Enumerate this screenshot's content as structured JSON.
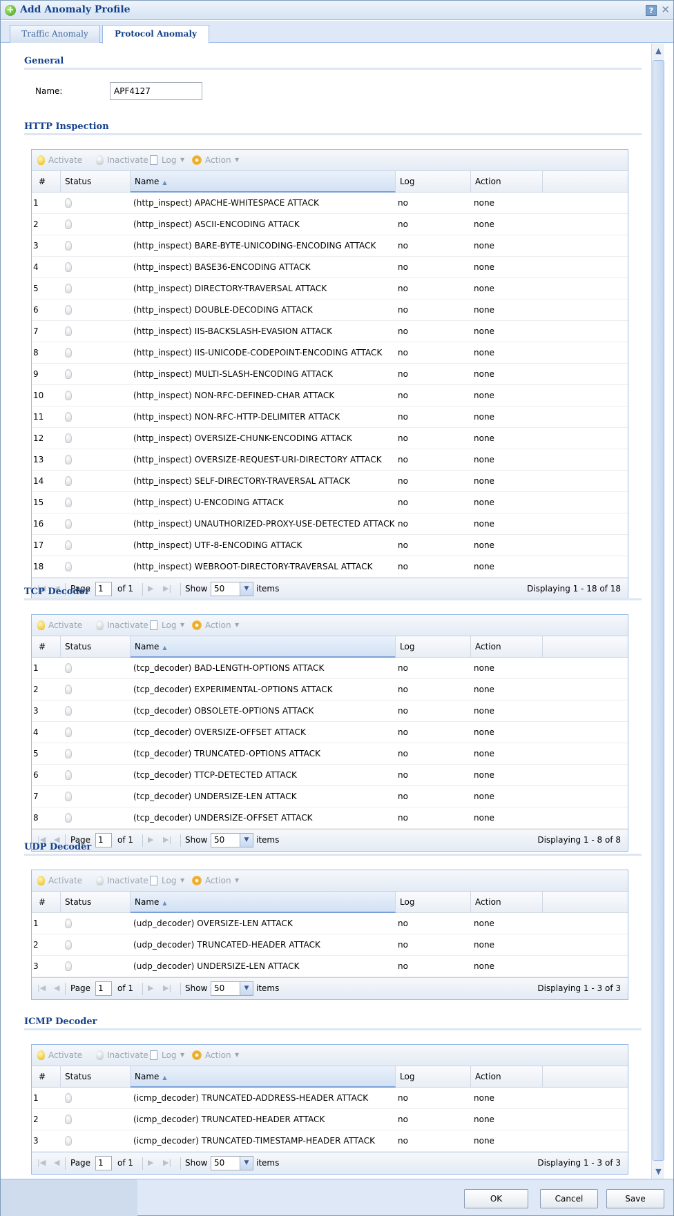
{
  "window": {
    "title": "Add Anomaly Profile",
    "help_label": "?",
    "close_label": "✕"
  },
  "tabs": [
    {
      "label": "Traffic Anomaly",
      "active": false
    },
    {
      "label": "Protocol Anomaly",
      "active": true
    }
  ],
  "general": {
    "title": "General",
    "name_label": "Name:",
    "name_value": "APF4127"
  },
  "toolbar": {
    "activate": "Activate",
    "inactivate": "Inactivate",
    "log": "Log",
    "action": "Action"
  },
  "columns": {
    "num": "#",
    "status": "Status",
    "name": "Name",
    "log": "Log",
    "action": "Action"
  },
  "pager": {
    "page_label": "Page",
    "page_value": "1",
    "of_label": "of 1",
    "show_label": "Show",
    "show_value": "50",
    "items_label": "items"
  },
  "sections": [
    {
      "title": "HTTP Inspection",
      "displaying": "Displaying 1 - 18 of 18",
      "rows": [
        {
          "num": "1",
          "name": "(http_inspect) APACHE-WHITESPACE ATTACK",
          "log": "no",
          "action": "none"
        },
        {
          "num": "2",
          "name": "(http_inspect) ASCII-ENCODING ATTACK",
          "log": "no",
          "action": "none"
        },
        {
          "num": "3",
          "name": "(http_inspect) BARE-BYTE-UNICODING-ENCODING ATTACK",
          "log": "no",
          "action": "none"
        },
        {
          "num": "4",
          "name": "(http_inspect) BASE36-ENCODING ATTACK",
          "log": "no",
          "action": "none"
        },
        {
          "num": "5",
          "name": "(http_inspect) DIRECTORY-TRAVERSAL ATTACK",
          "log": "no",
          "action": "none"
        },
        {
          "num": "6",
          "name": "(http_inspect) DOUBLE-DECODING ATTACK",
          "log": "no",
          "action": "none"
        },
        {
          "num": "7",
          "name": "(http_inspect) IIS-BACKSLASH-EVASION ATTACK",
          "log": "no",
          "action": "none"
        },
        {
          "num": "8",
          "name": "(http_inspect) IIS-UNICODE-CODEPOINT-ENCODING ATTACK",
          "log": "no",
          "action": "none"
        },
        {
          "num": "9",
          "name": "(http_inspect) MULTI-SLASH-ENCODING ATTACK",
          "log": "no",
          "action": "none"
        },
        {
          "num": "10",
          "name": "(http_inspect) NON-RFC-DEFINED-CHAR ATTACK",
          "log": "no",
          "action": "none"
        },
        {
          "num": "11",
          "name": "(http_inspect) NON-RFC-HTTP-DELIMITER ATTACK",
          "log": "no",
          "action": "none"
        },
        {
          "num": "12",
          "name": "(http_inspect) OVERSIZE-CHUNK-ENCODING ATTACK",
          "log": "no",
          "action": "none"
        },
        {
          "num": "13",
          "name": "(http_inspect) OVERSIZE-REQUEST-URI-DIRECTORY ATTACK",
          "log": "no",
          "action": "none"
        },
        {
          "num": "14",
          "name": "(http_inspect) SELF-DIRECTORY-TRAVERSAL ATTACK",
          "log": "no",
          "action": "none"
        },
        {
          "num": "15",
          "name": "(http_inspect) U-ENCODING ATTACK",
          "log": "no",
          "action": "none"
        },
        {
          "num": "16",
          "name": "(http_inspect) UNAUTHORIZED-PROXY-USE-DETECTED ATTACK",
          "log": "no",
          "action": "none"
        },
        {
          "num": "17",
          "name": "(http_inspect) UTF-8-ENCODING ATTACK",
          "log": "no",
          "action": "none"
        },
        {
          "num": "18",
          "name": "(http_inspect) WEBROOT-DIRECTORY-TRAVERSAL ATTACK",
          "log": "no",
          "action": "none"
        }
      ]
    },
    {
      "title": "TCP Decoder",
      "displaying": "Displaying 1 - 8 of 8",
      "rows": [
        {
          "num": "1",
          "name": "(tcp_decoder) BAD-LENGTH-OPTIONS ATTACK",
          "log": "no",
          "action": "none"
        },
        {
          "num": "2",
          "name": "(tcp_decoder) EXPERIMENTAL-OPTIONS ATTACK",
          "log": "no",
          "action": "none"
        },
        {
          "num": "3",
          "name": "(tcp_decoder) OBSOLETE-OPTIONS ATTACK",
          "log": "no",
          "action": "none"
        },
        {
          "num": "4",
          "name": "(tcp_decoder) OVERSIZE-OFFSET ATTACK",
          "log": "no",
          "action": "none"
        },
        {
          "num": "5",
          "name": "(tcp_decoder) TRUNCATED-OPTIONS ATTACK",
          "log": "no",
          "action": "none"
        },
        {
          "num": "6",
          "name": "(tcp_decoder) TTCP-DETECTED ATTACK",
          "log": "no",
          "action": "none"
        },
        {
          "num": "7",
          "name": "(tcp_decoder) UNDERSIZE-LEN ATTACK",
          "log": "no",
          "action": "none"
        },
        {
          "num": "8",
          "name": "(tcp_decoder) UNDERSIZE-OFFSET ATTACK",
          "log": "no",
          "action": "none"
        }
      ]
    },
    {
      "title": "UDP Decoder",
      "displaying": "Displaying 1 - 3 of 3",
      "rows": [
        {
          "num": "1",
          "name": "(udp_decoder) OVERSIZE-LEN ATTACK",
          "log": "no",
          "action": "none"
        },
        {
          "num": "2",
          "name": "(udp_decoder) TRUNCATED-HEADER ATTACK",
          "log": "no",
          "action": "none"
        },
        {
          "num": "3",
          "name": "(udp_decoder) UNDERSIZE-LEN ATTACK",
          "log": "no",
          "action": "none"
        }
      ]
    },
    {
      "title": "ICMP Decoder",
      "displaying": "Displaying 1 - 3 of 3",
      "rows": [
        {
          "num": "1",
          "name": "(icmp_decoder) TRUNCATED-ADDRESS-HEADER ATTACK",
          "log": "no",
          "action": "none"
        },
        {
          "num": "2",
          "name": "(icmp_decoder) TRUNCATED-HEADER ATTACK",
          "log": "no",
          "action": "none"
        },
        {
          "num": "3",
          "name": "(icmp_decoder) TRUNCATED-TIMESTAMP-HEADER ATTACK",
          "log": "no",
          "action": "none"
        }
      ]
    }
  ],
  "buttons": {
    "ok": "OK",
    "cancel": "Cancel",
    "save": "Save"
  },
  "icons": {
    "add": "add-icon",
    "help": "help-icon",
    "close": "close-icon",
    "status": "bulb-icon",
    "log": "document-icon",
    "action": "gear-icon"
  },
  "colors": {
    "title_text": "#15428b",
    "tab_bar": "#dfe8f6",
    "border": "#99bbe8"
  }
}
